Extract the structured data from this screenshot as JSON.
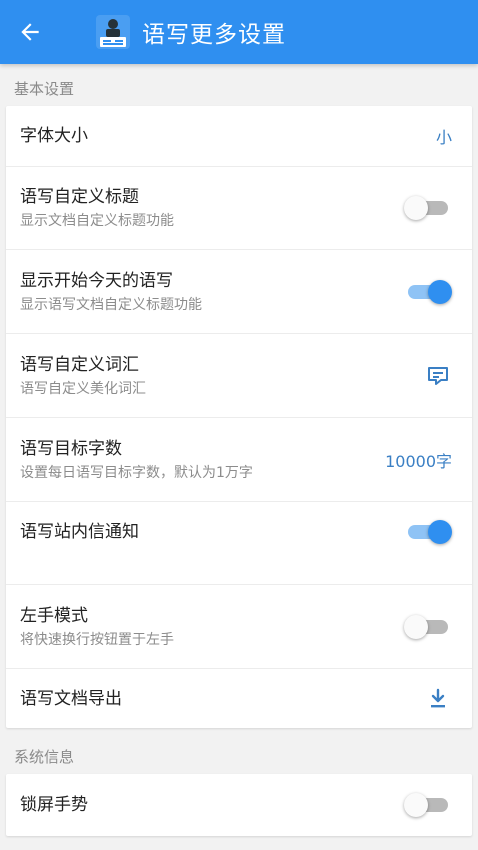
{
  "appbar": {
    "title": "语写更多设置",
    "back_icon": "arrow-left-icon",
    "logo_icon": "app-logo-icon"
  },
  "colors": {
    "primary": "#2f8ff0",
    "accent_text": "#3a7fc4"
  },
  "sections": [
    {
      "header": "基本设置",
      "rows": [
        {
          "title": "字体大小",
          "subtitle": "",
          "control": "value",
          "value": "小"
        },
        {
          "title": "语写自定义标题",
          "subtitle": "显示文档自定义标题功能",
          "control": "toggle",
          "on": false
        },
        {
          "title": "显示开始今天的语写",
          "subtitle": "显示语写文档自定义标题功能",
          "control": "toggle",
          "on": true
        },
        {
          "title": "语写自定义词汇",
          "subtitle": "语写自定义美化词汇",
          "control": "icon",
          "icon": "edit-note-icon"
        },
        {
          "title": "语写目标字数",
          "subtitle": "设置每日语写目标字数，默认为1万字",
          "control": "value",
          "value": "10000字"
        },
        {
          "title": "语写站内信通知",
          "subtitle": "",
          "control": "toggle",
          "on": true
        },
        {
          "title": "左手模式",
          "subtitle": "将快速换行按钮置于左手",
          "control": "toggle",
          "on": false
        },
        {
          "title": "语写文档导出",
          "subtitle": "",
          "control": "icon",
          "icon": "download-icon"
        }
      ]
    },
    {
      "header": "系统信息",
      "rows": [
        {
          "title": "锁屏手势",
          "subtitle": "",
          "control": "toggle",
          "on": false
        }
      ]
    }
  ]
}
